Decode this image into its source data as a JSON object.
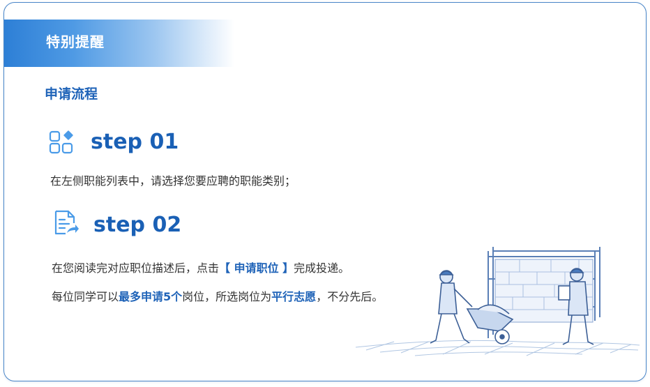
{
  "notice": {
    "title": "特别提醒"
  },
  "process": {
    "title": "申请流程"
  },
  "steps": [
    {
      "label": "step 01",
      "icon": "grid-apps-icon",
      "text": "在左侧职能列表中，请选择您要应聘的职能类别；"
    },
    {
      "label": "step 02",
      "icon": "document-send-icon",
      "text_before": "在您阅读完对应职位描述后，点击",
      "text_highlight": "【 申请职位 】",
      "text_after": "完成投递。",
      "rule_part1": "每位同学可以",
      "rule_highlight1": "最多申请5个",
      "rule_part2": "岗位，所选岗位为",
      "rule_highlight2": "平行志愿",
      "rule_part3": "，不分先后。"
    }
  ],
  "colors": {
    "accent": "#1f63b8",
    "border": "#4a86c8",
    "icon": "#4a9be8"
  }
}
